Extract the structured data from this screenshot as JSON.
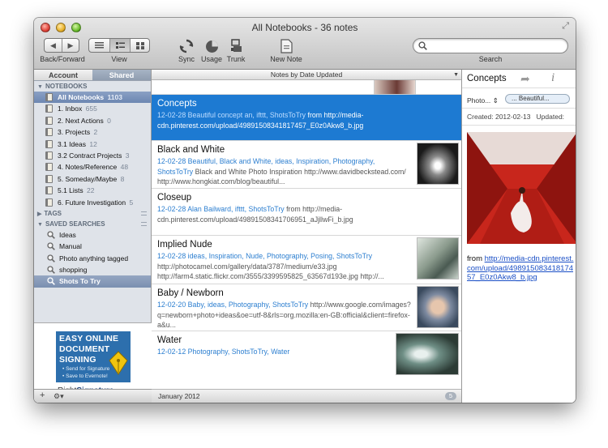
{
  "window": {
    "title": "All Notebooks - 36 notes"
  },
  "toolbar": {
    "back_forward_label": "Back/Forward",
    "view_label": "View",
    "sync_label": "Sync",
    "usage_label": "Usage",
    "trunk_label": "Trunk",
    "new_note_label": "New Note",
    "search_label": "Search",
    "search_placeholder": ""
  },
  "sidebar": {
    "tabs": [
      "Account",
      "Shared"
    ],
    "notebooks_header": "NOTEBOOKS",
    "notebooks": [
      {
        "name": "All Notebooks",
        "count": "1103"
      },
      {
        "name": "1. Inbox",
        "count": "655"
      },
      {
        "name": "2. Next Actions",
        "count": "0"
      },
      {
        "name": "3. Projects",
        "count": "2"
      },
      {
        "name": "3.1 Ideas",
        "count": "12"
      },
      {
        "name": "3.2 Contract Projects",
        "count": "3"
      },
      {
        "name": "4. Notes/Reference",
        "count": "48"
      },
      {
        "name": "5. Someday/Maybe",
        "count": "8"
      },
      {
        "name": "5.1 Lists",
        "count": "22"
      },
      {
        "name": "6. Future Investigation",
        "count": "5"
      }
    ],
    "tags_header": "TAGS",
    "saved_searches_header": "SAVED SEARCHES",
    "saved_searches": [
      "Ideas",
      "Manual",
      "Photo anything tagged",
      "shopping",
      "Shots To Try"
    ],
    "ad": {
      "line1": "EASY ONLINE",
      "line2": "DOCUMENT",
      "line3": "SIGNING",
      "bullet1": "• Send for Signature",
      "bullet2": "• Save to Evernote!",
      "brand_a": "Right",
      "brand_b": "Signature"
    },
    "add_label": "+",
    "gear_label": "⚙▾"
  },
  "note_list": {
    "sort_label": "Notes by Date Updated",
    "notes": [
      {
        "title": "Concepts",
        "date": "12-02-28",
        "tags": "Beautiful concept an, ifttt, ShotsToTry",
        "snippet": "from http://media-cdn.pinterest.com/upload/49891508341817457_E0z0Akw8_b.jpg"
      },
      {
        "title": "Black and White",
        "date": "12-02-28",
        "tags": "Beautiful, Black and White, ideas, Inspiration, Photography, ShotsToTry",
        "snippet": "Black and White Photo Inspiration http://www.davidbeckstead.com/ http://www.hongkiat.com/blog/beautiful..."
      },
      {
        "title": "Closeup",
        "date": "12-02-28",
        "tags": "Alan Bailward, ifttt, ShotsToTry",
        "snippet": "from http://media-cdn.pinterest.com/upload/49891508341706951_aJjllwFi_b.jpg"
      },
      {
        "title": "Implied Nude",
        "date": "12-02-28",
        "tags": "ideas, Inspiration, Nude, Photography, Posing, ShotsToTry",
        "snippet": "http://photocamel.com/gallery/data/3787/medium/e33.jpg http://farm4.static.flickr.com/3555/3399595825_63567d193e.jpg http://..."
      },
      {
        "title": "Baby / Newborn",
        "date": "12-02-20",
        "tags": "Baby, ideas, Photography, ShotsToTry",
        "snippet": "http://www.google.com/images?q=newborn+photo+ideas&oe=utf-8&rls=org.mozilla:en-GB:official&client=firefox-a&u..."
      },
      {
        "title": "Water",
        "date": "12-02-12",
        "tags": "Photography, ShotsToTry, Water",
        "snippet": ""
      }
    ],
    "group_label": "January 2012",
    "group_count": "5"
  },
  "detail": {
    "title": "Concepts",
    "notebook": "Photo...",
    "tag": "... Beautiful...",
    "created": "Created: 2012-02-13",
    "updated": "Updated:",
    "from_prefix": "from",
    "link": "http://media-cdn.pinterest.com/upload/49891508341817457_E0z0Akw8_b.jpg"
  },
  "colors": {
    "selection_blue": "#1d7ad2",
    "meta_blue": "#2d7fd0",
    "sidebar_bg": "#dfe3e9"
  }
}
